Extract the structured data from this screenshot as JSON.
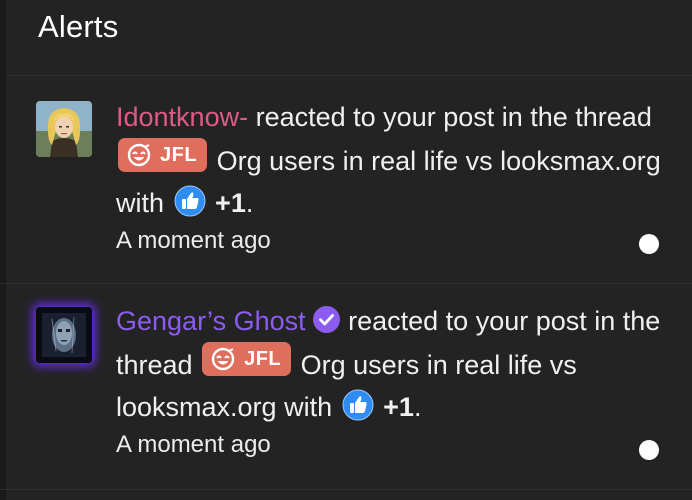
{
  "header": {
    "title": "Alerts"
  },
  "alerts": [
    {
      "username": "Idontknow-",
      "text_before_thread": "reacted to your post in the thread",
      "prefix_label": "JFL",
      "thread_title": "Org users in real life vs looksmax.org",
      "with_word": "with",
      "reaction_label": "+1",
      "period": ".",
      "time": "A moment ago",
      "avatar_icon": "blonde-character-avatar",
      "unread": true
    },
    {
      "username": "Gengar’s Ghost",
      "verified_icon": "verified-check-icon",
      "text_before_thread": "reacted to your post in the thread",
      "prefix_label": "JFL",
      "thread_title": "Org users in real life vs looksmax.org",
      "with_word": "with",
      "reaction_label": "+1",
      "period": ".",
      "time": "A moment ago",
      "avatar_icon": "ghost-face-avatar",
      "unread": true
    }
  ],
  "colors": {
    "background": "#232323",
    "username_1": "#e05a86",
    "username_2": "#8c5cf0",
    "prefix_bg": "#e06e5c",
    "like_blue": "#2f8cf0",
    "verified_purple": "#8c5cf0",
    "avatar_glow": "#6c2cff"
  }
}
